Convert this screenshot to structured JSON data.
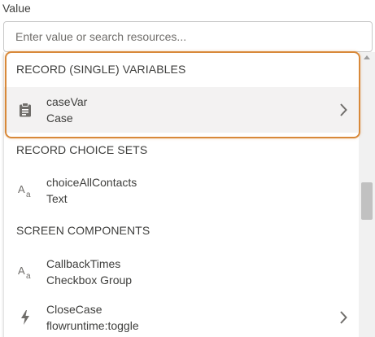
{
  "field": {
    "label": "Value",
    "placeholder": "Enter value or search resources..."
  },
  "groups": [
    {
      "header": "RECORD (SINGLE) VARIABLES",
      "items": [
        {
          "title": "caseVar",
          "subtitle": "Case",
          "icon": "record-clipboard-icon",
          "selected": true,
          "has_chevron": true
        }
      ]
    },
    {
      "header": "RECORD CHOICE SETS",
      "items": [
        {
          "title": "choiceAllContacts",
          "subtitle": "Text",
          "icon": "text-type-icon",
          "selected": false,
          "has_chevron": false
        }
      ]
    },
    {
      "header": "SCREEN COMPONENTS",
      "items": [
        {
          "title": "CallbackTimes",
          "subtitle": "Checkbox Group",
          "icon": "text-type-icon",
          "selected": false,
          "has_chevron": false
        },
        {
          "title": "CloseCase",
          "subtitle": "flowruntime:toggle",
          "icon": "lightning-icon",
          "selected": false,
          "has_chevron": true
        }
      ]
    }
  ],
  "colors": {
    "highlight_border": "#d8893a",
    "selected_row": "#f3f2f2",
    "icon_gray": "#706e6b",
    "text": "#3e3e3c"
  }
}
